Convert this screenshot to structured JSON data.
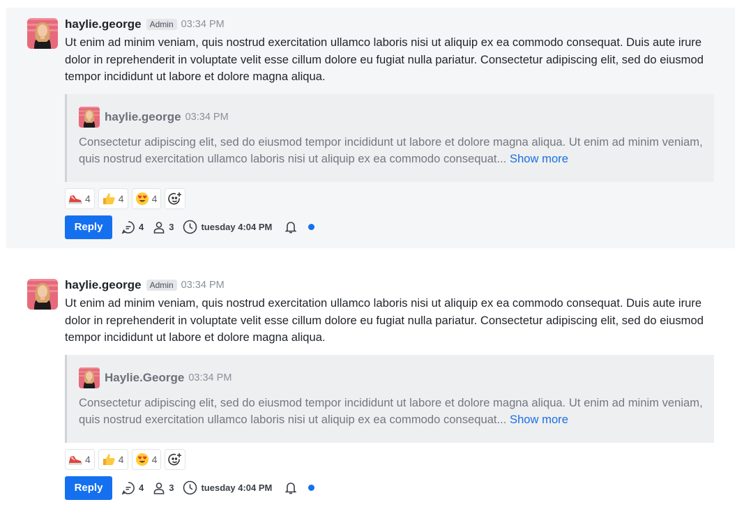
{
  "messages": [
    {
      "username": "haylie.george",
      "role": "Admin",
      "time": "03:34 PM",
      "body": "Ut enim ad minim veniam, quis nostrud exercitation ullamco laboris nisi ut aliquip ex ea commodo consequat. Duis aute irure dolor in reprehenderit in voluptate velit esse cillum dolore eu fugiat nulla pariatur. Consectetur adipiscing elit, sed do eiusmod tempor incididunt ut labore et dolore magna aliqua.",
      "quote": {
        "username": "haylie.george",
        "time": "03:34 PM",
        "body": "Consectetur adipiscing elit, sed do eiusmod tempor incididunt ut labore et dolore magna aliqua. Ut enim ad minim veniam, quis nostrud exercitation ullamco laboris nisi ut aliquip ex ea commodo consequat...",
        "show_more": "Show more"
      },
      "reactions": [
        {
          "icon": "sneaker-icon",
          "count": "4"
        },
        {
          "icon": "thumbs-up-icon",
          "count": "4"
        },
        {
          "icon": "heart-eyes-icon",
          "count": "4"
        }
      ],
      "reply_label": "Reply",
      "replies_count": "4",
      "participants_count": "3",
      "last_reply": "tuesday 4:04 PM",
      "accent": "#1570ef"
    },
    {
      "username": "haylie.george",
      "role": "Admin",
      "time": "03:34 PM",
      "body": "Ut enim ad minim veniam, quis nostrud exercitation ullamco laboris nisi ut aliquip ex ea commodo consequat. Duis aute irure dolor in reprehenderit in voluptate velit esse cillum dolore eu fugiat nulla pariatur. Consectetur adipiscing elit, sed do eiusmod tempor incididunt ut labore et dolore magna aliqua.",
      "quote": {
        "username": "Haylie.George",
        "time": "03:34 PM",
        "body": "Consectetur adipiscing elit, sed do eiusmod tempor incididunt ut labore et dolore magna aliqua. Ut enim ad minim veniam, quis nostrud exercitation ullamco laboris nisi ut aliquip ex ea commodo consequat...",
        "show_more": "Show more"
      },
      "reactions": [
        {
          "icon": "sneaker-icon",
          "count": "4"
        },
        {
          "icon": "thumbs-up-icon",
          "count": "4"
        },
        {
          "icon": "heart-eyes-icon",
          "count": "4"
        }
      ],
      "reply_label": "Reply",
      "replies_count": "4",
      "participants_count": "3",
      "last_reply": "tuesday 4:04 PM",
      "accent": "#1570ef"
    }
  ]
}
